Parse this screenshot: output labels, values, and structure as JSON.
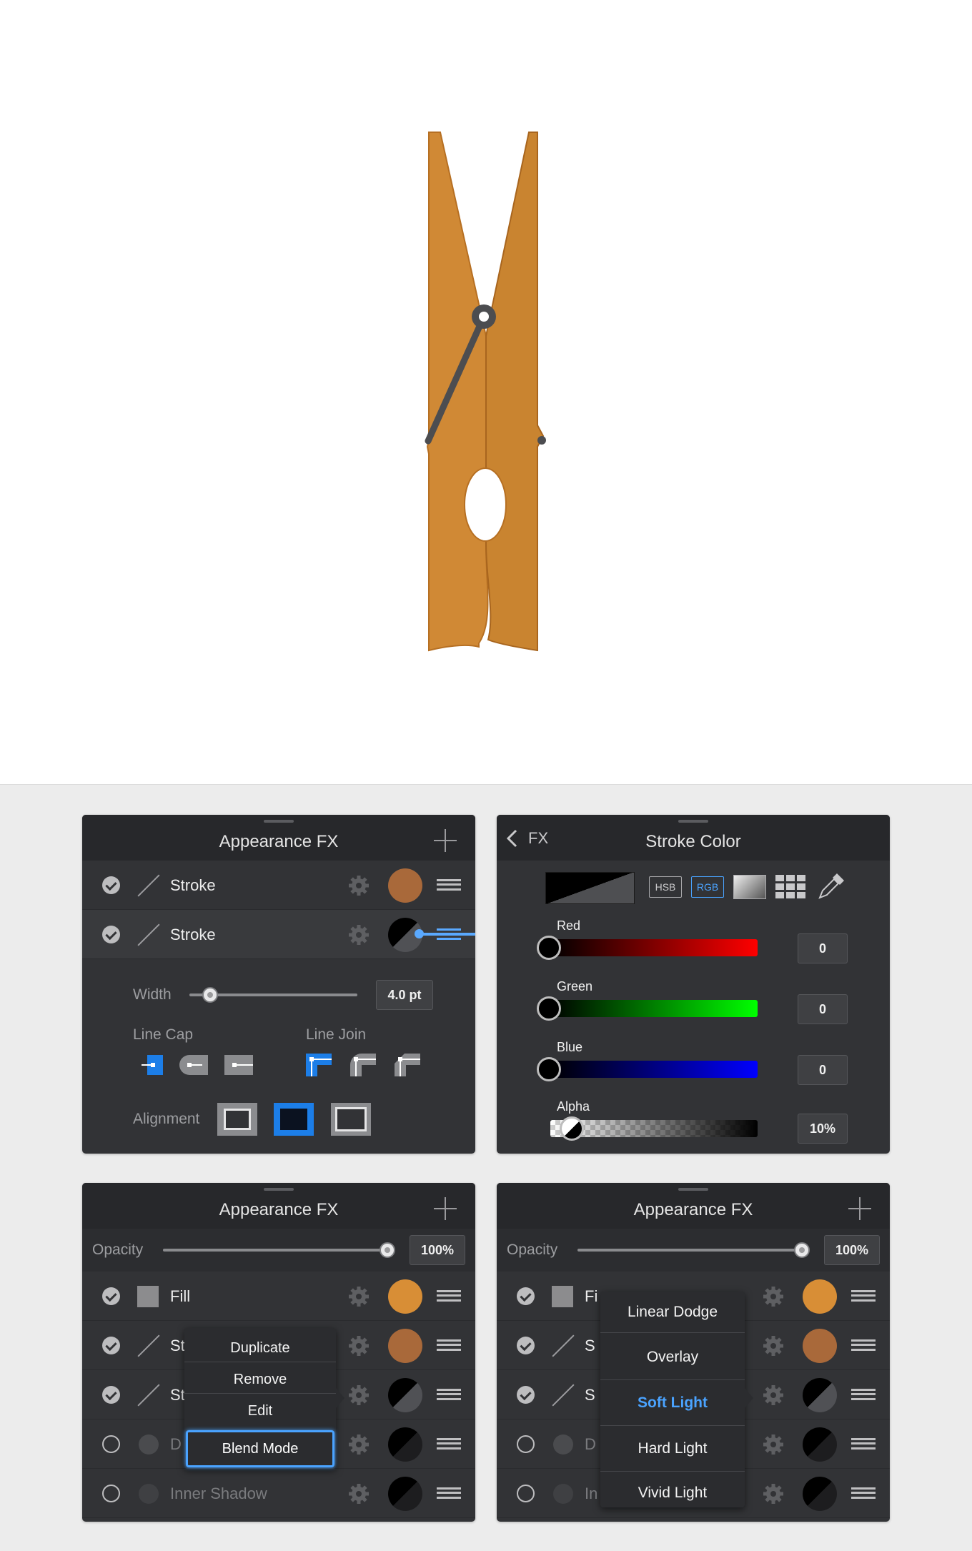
{
  "colors": {
    "accent": "#1c7ee8",
    "panel_bg": "#323336",
    "header_bg": "#27282b",
    "clothespin": "#d08935",
    "fill_swatch": "#d88e36",
    "stroke_swatch": "#a9693a",
    "highlight_text": "#4aa3ff"
  },
  "panel_fx_stroke": {
    "title": "Appearance FX",
    "rows": [
      {
        "label": "Stroke",
        "icon": "stroke-icon",
        "swatch": "#a9693a"
      },
      {
        "label": "Stroke",
        "icon": "stroke-icon",
        "swatch": "black-gray-split"
      }
    ],
    "width_label": "Width",
    "width_value": "4.0 pt",
    "width_fraction": 0.08,
    "line_cap_label": "Line Cap",
    "line_cap_selected": "butt",
    "line_join_label": "Line Join",
    "line_join_selected": "miter",
    "alignment_label": "Alignment",
    "alignment_selected": "center"
  },
  "panel_stroke_color": {
    "back_label": "FX",
    "title": "Stroke Color",
    "modes": [
      "HSB",
      "RGB"
    ],
    "active_mode": "RGB",
    "channels": [
      {
        "label": "Red",
        "value": "0",
        "color": "#ff0000",
        "level": 0
      },
      {
        "label": "Green",
        "value": "0",
        "color": "#00ff00",
        "level": 0
      },
      {
        "label": "Blue",
        "value": "0",
        "color": "#0000ff",
        "level": 0
      },
      {
        "label": "Alpha",
        "value": "10%",
        "color": "#000000",
        "level": 0.1
      }
    ]
  },
  "panel_fx_context": {
    "title": "Appearance FX",
    "opacity_label": "Opacity",
    "opacity_value": "100%",
    "rows": [
      {
        "label": "Fill",
        "checked": true
      },
      {
        "label": "St",
        "checked": true
      },
      {
        "label": "St",
        "checked": true
      },
      {
        "label": "D",
        "checked": false
      },
      {
        "label": "Inner Shadow",
        "checked": false
      }
    ],
    "context_menu": [
      "Duplicate",
      "Remove",
      "Edit",
      "Blend Mode"
    ],
    "context_selected": "Blend Mode"
  },
  "panel_fx_blend": {
    "title": "Appearance FX",
    "opacity_label": "Opacity",
    "opacity_value": "100%",
    "rows": [
      {
        "label": "Fi",
        "checked": true
      },
      {
        "label": "S",
        "checked": true
      },
      {
        "label": "S",
        "checked": true
      },
      {
        "label": "D",
        "checked": false
      },
      {
        "label": "In",
        "checked": false
      }
    ],
    "blend_modes": [
      "Linear Dodge",
      "Overlay",
      "Soft Light",
      "Hard Light",
      "Vivid Light"
    ],
    "blend_selected": "Soft Light"
  }
}
